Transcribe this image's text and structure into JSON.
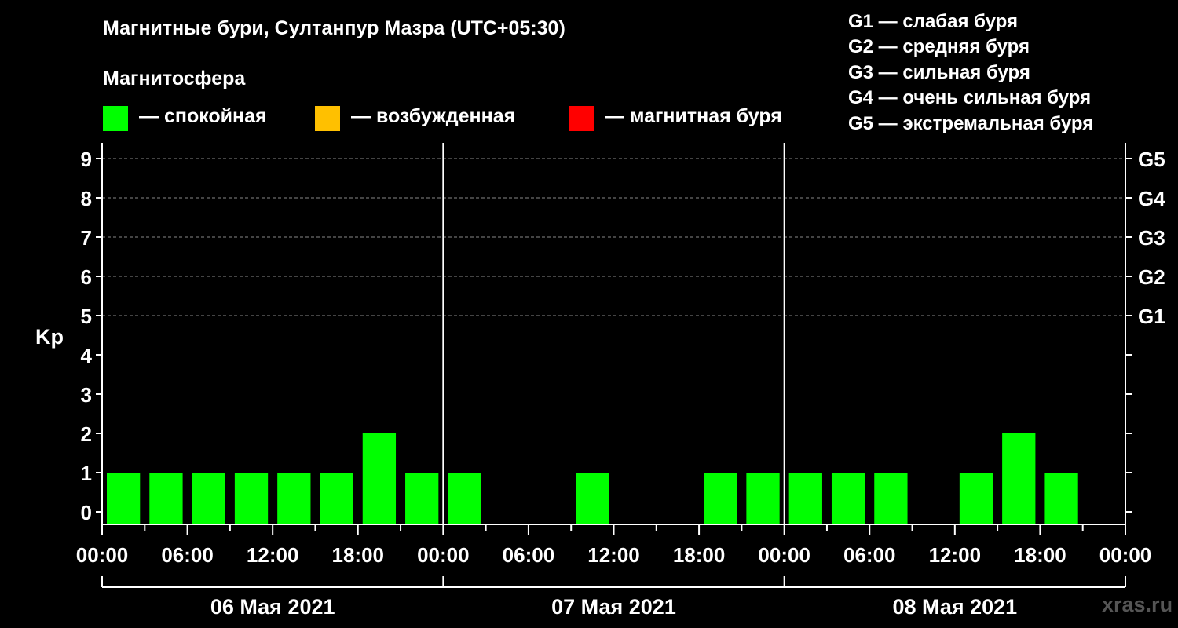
{
  "colors": {
    "quiet": "#00ff00",
    "excited": "#ffc000",
    "storm": "#ff0000",
    "background": "#000000",
    "axis": "#ffffff",
    "grid": "#888888"
  },
  "header": {
    "title": "Магнитные бури, Султанпур Мазра (UTC+05:30)",
    "subtitle": "Магнитосфера"
  },
  "legend": {
    "quiet": "— спокойная",
    "excited": "— возбужденная",
    "storm": "— магнитная буря"
  },
  "g_legend": [
    "G1 — слабая буря",
    "G2 — средняя буря",
    "G3 — сильная буря",
    "G4 — очень сильная буря",
    "G5 — экстремальная буря"
  ],
  "watermark": "xras.ru",
  "chart_data": {
    "type": "bar",
    "ylabel": "Kp",
    "ylim": [
      0,
      9
    ],
    "yticks": [
      0,
      1,
      2,
      3,
      4,
      5,
      6,
      7,
      8,
      9
    ],
    "right_ticks": [
      {
        "kp": 5,
        "label": "G1"
      },
      {
        "kp": 6,
        "label": "G2"
      },
      {
        "kp": 7,
        "label": "G3"
      },
      {
        "kp": 8,
        "label": "G4"
      },
      {
        "kp": 9,
        "label": "G5"
      }
    ],
    "x_hours_range": [
      0,
      72
    ],
    "x_tick_labels": [
      "00:00",
      "06:00",
      "12:00",
      "18:00",
      "00:00",
      "06:00",
      "12:00",
      "18:00",
      "00:00",
      "06:00",
      "12:00",
      "18:00",
      "00:00"
    ],
    "days": [
      "06 Мая 2021",
      "07 Мая 2021",
      "08 Мая 2021"
    ],
    "series": [
      {
        "values": [
          1,
          1,
          1,
          1,
          1,
          1,
          2,
          1,
          1,
          0,
          0,
          1,
          0,
          0,
          1,
          1,
          1,
          1,
          1,
          0,
          1,
          2,
          1,
          0
        ]
      }
    ],
    "grid": true
  }
}
